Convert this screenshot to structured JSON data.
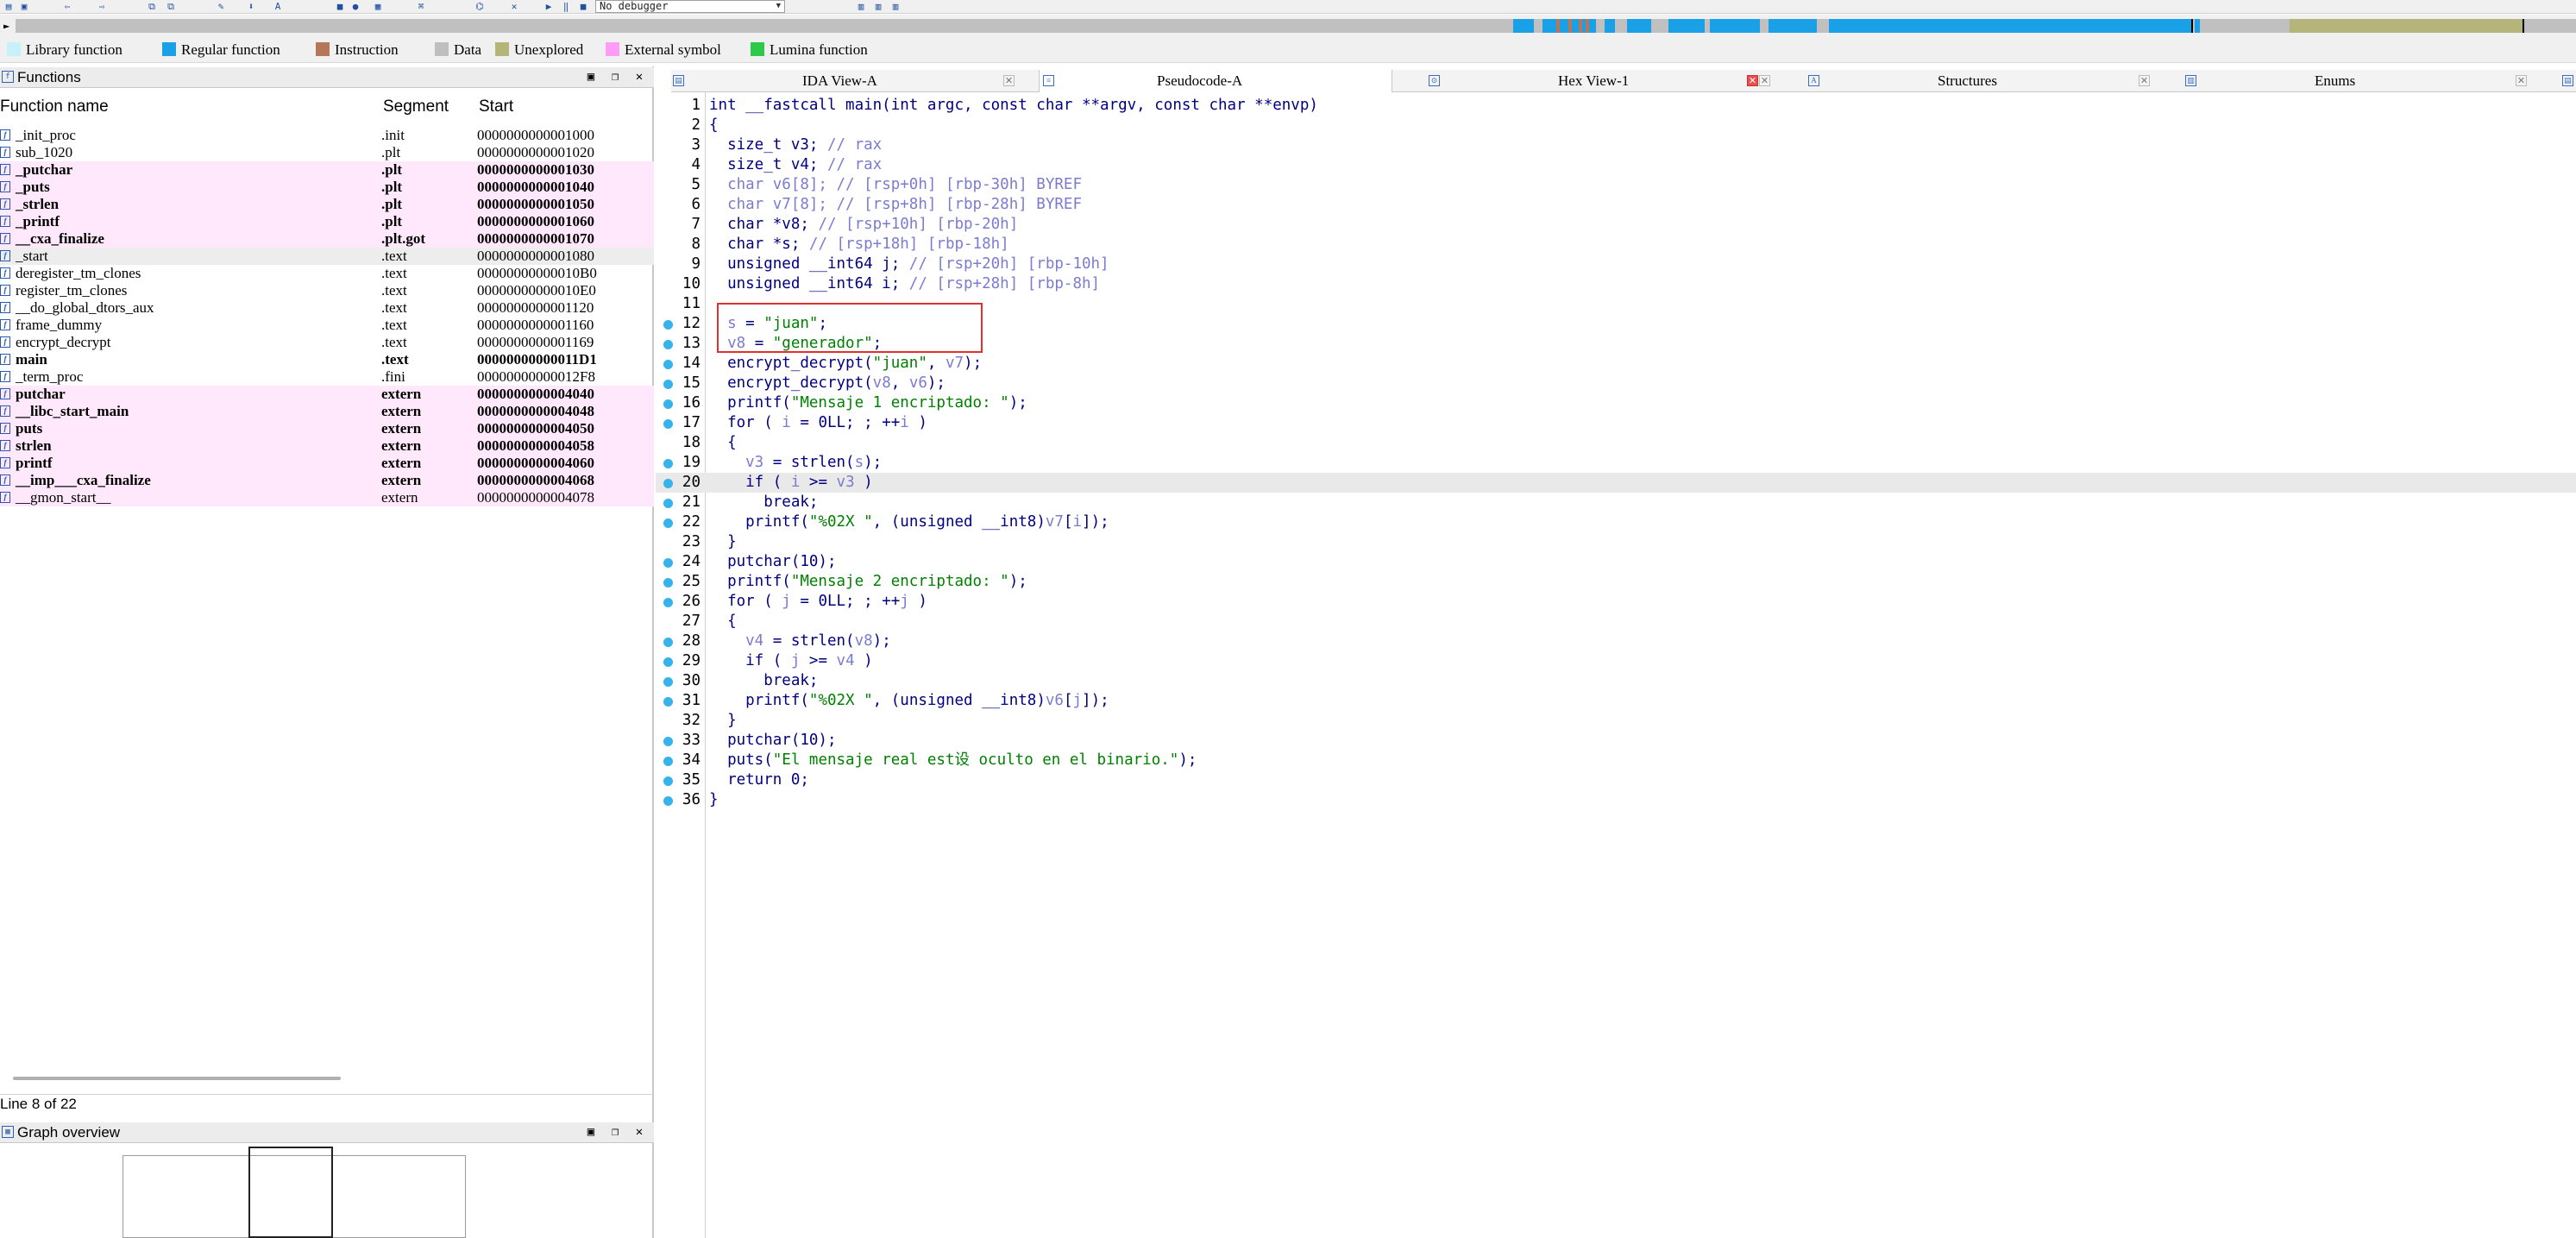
{
  "toolbar": {
    "debugger_select": "No debugger"
  },
  "legend": [
    {
      "label": "Library function",
      "color": "#c8f0f8"
    },
    {
      "label": "Regular function",
      "color": "#1aa0e6"
    },
    {
      "label": "Instruction",
      "color": "#b5765a"
    },
    {
      "label": "Data",
      "color": "#bfbfbf"
    },
    {
      "label": "Unexplored",
      "color": "#b5b47a"
    },
    {
      "label": "External symbol",
      "color": "#ff9cf5"
    },
    {
      "label": "Lumina function",
      "color": "#2ec84a"
    }
  ],
  "functions_panel": {
    "title": "Functions",
    "columns": [
      "Function name",
      "Segment",
      "Start"
    ],
    "rows": [
      {
        "name": "_init_proc",
        "segment": ".init",
        "start": "0000000000001000",
        "style": "normal"
      },
      {
        "name": "sub_1020",
        "segment": ".plt",
        "start": "0000000000001020",
        "style": "normal"
      },
      {
        "name": "_putchar",
        "segment": ".plt",
        "start": "0000000000001030",
        "style": "pink-bold"
      },
      {
        "name": "_puts",
        "segment": ".plt",
        "start": "0000000000001040",
        "style": "pink-bold"
      },
      {
        "name": "_strlen",
        "segment": ".plt",
        "start": "0000000000001050",
        "style": "pink-bold"
      },
      {
        "name": "_printf",
        "segment": ".plt",
        "start": "0000000000001060",
        "style": "pink-bold"
      },
      {
        "name": "__cxa_finalize",
        "segment": ".plt.got",
        "start": "0000000000001070",
        "style": "pink-bold"
      },
      {
        "name": "_start",
        "segment": ".text",
        "start": "0000000000001080",
        "style": "selected"
      },
      {
        "name": "deregister_tm_clones",
        "segment": ".text",
        "start": "00000000000010B0",
        "style": "normal"
      },
      {
        "name": "register_tm_clones",
        "segment": ".text",
        "start": "00000000000010E0",
        "style": "normal"
      },
      {
        "name": "__do_global_dtors_aux",
        "segment": ".text",
        "start": "0000000000001120",
        "style": "normal"
      },
      {
        "name": "frame_dummy",
        "segment": ".text",
        "start": "0000000000001160",
        "style": "normal"
      },
      {
        "name": "encrypt_decrypt",
        "segment": ".text",
        "start": "0000000000001169",
        "style": "normal"
      },
      {
        "name": "main",
        "segment": ".text",
        "start": "00000000000011D1",
        "style": "bold"
      },
      {
        "name": "_term_proc",
        "segment": ".fini",
        "start": "00000000000012F8",
        "style": "normal"
      },
      {
        "name": "putchar",
        "segment": "extern",
        "start": "0000000000004040",
        "style": "pink-bold"
      },
      {
        "name": "__libc_start_main",
        "segment": "extern",
        "start": "0000000000004048",
        "style": "pink-bold"
      },
      {
        "name": "puts",
        "segment": "extern",
        "start": "0000000000004050",
        "style": "pink-bold"
      },
      {
        "name": "strlen",
        "segment": "extern",
        "start": "0000000000004058",
        "style": "pink-bold"
      },
      {
        "name": "printf",
        "segment": "extern",
        "start": "0000000000004060",
        "style": "pink-bold"
      },
      {
        "name": "__imp___cxa_finalize",
        "segment": "extern",
        "start": "0000000000004068",
        "style": "pink-bold"
      },
      {
        "name": "__gmon_start__",
        "segment": "extern",
        "start": "0000000000004078",
        "style": "pink"
      }
    ],
    "status": "Line 8 of 22"
  },
  "graph_overview": {
    "title": "Graph overview"
  },
  "tabs": [
    {
      "label": "IDA View-A",
      "icon": "ida-view-icon",
      "active": false
    },
    {
      "label": "Pseudocode-A",
      "icon": "pseudocode-icon",
      "active": true
    },
    {
      "label": "Hex View-1",
      "icon": "hex-view-icon",
      "active": false
    },
    {
      "label": "Structures",
      "icon": "structures-icon",
      "active": false
    },
    {
      "label": "Enums",
      "icon": "enums-icon",
      "active": false
    }
  ],
  "pseudocode": {
    "highlighted_line": 20,
    "lines": [
      {
        "n": "1",
        "bp": false,
        "parts": [
          [
            "int __fastcall main(int argc, const char **argv, const char **envp)",
            "kw"
          ]
        ]
      },
      {
        "n": "2",
        "bp": false,
        "parts": [
          [
            "{",
            "kw"
          ]
        ]
      },
      {
        "n": "3",
        "bp": false,
        "parts": [
          [
            "  size_t v3; ",
            "kw"
          ],
          [
            "// rax",
            "com"
          ]
        ]
      },
      {
        "n": "4",
        "bp": false,
        "parts": [
          [
            "  size_t v4; ",
            "kw"
          ],
          [
            "// rax",
            "com"
          ]
        ]
      },
      {
        "n": "5",
        "bp": false,
        "parts": [
          [
            "  char v6[8]; ",
            "com"
          ],
          [
            "// [rsp+0h] [rbp-30h] BYREF",
            "com"
          ]
        ]
      },
      {
        "n": "6",
        "bp": false,
        "parts": [
          [
            "  char v7[8]; ",
            "com"
          ],
          [
            "// [rsp+8h] [rbp-28h] BYREF",
            "com"
          ]
        ]
      },
      {
        "n": "7",
        "bp": false,
        "parts": [
          [
            "  char *v8; ",
            "kw"
          ],
          [
            "// [rsp+10h] [rbp-20h]",
            "com"
          ]
        ]
      },
      {
        "n": "8",
        "bp": false,
        "parts": [
          [
            "  char *s; ",
            "kw"
          ],
          [
            "// [rsp+18h] [rbp-18h]",
            "com"
          ]
        ]
      },
      {
        "n": "9",
        "bp": false,
        "parts": [
          [
            "  unsigned __int64 j; ",
            "kw"
          ],
          [
            "// [rsp+20h] [rbp-10h]",
            "com"
          ]
        ]
      },
      {
        "n": "10",
        "bp": false,
        "parts": [
          [
            "  unsigned __int64 i; ",
            "kw"
          ],
          [
            "// [rsp+28h] [rbp-8h]",
            "com"
          ]
        ]
      },
      {
        "n": "11",
        "bp": false,
        "parts": [
          [
            "",
            "kw"
          ]
        ]
      },
      {
        "n": "12",
        "bp": true,
        "parts": [
          [
            "  s",
            "var"
          ],
          [
            " = ",
            "kw"
          ],
          [
            "\"juan\"",
            "str"
          ],
          [
            ";",
            "kw"
          ]
        ]
      },
      {
        "n": "13",
        "bp": true,
        "parts": [
          [
            "  v8",
            "var"
          ],
          [
            " = ",
            "kw"
          ],
          [
            "\"generador\"",
            "str"
          ],
          [
            ";",
            "kw"
          ]
        ]
      },
      {
        "n": "14",
        "bp": true,
        "parts": [
          [
            "  encrypt_decrypt(",
            "kw"
          ],
          [
            "\"juan\"",
            "str"
          ],
          [
            ", ",
            "kw"
          ],
          [
            "v7",
            "var"
          ],
          [
            ");",
            "kw"
          ]
        ]
      },
      {
        "n": "15",
        "bp": true,
        "parts": [
          [
            "  encrypt_decrypt(",
            "kw"
          ],
          [
            "v8",
            "var"
          ],
          [
            ", ",
            "kw"
          ],
          [
            "v6",
            "var"
          ],
          [
            ");",
            "kw"
          ]
        ]
      },
      {
        "n": "16",
        "bp": true,
        "parts": [
          [
            "  printf(",
            "kw"
          ],
          [
            "\"Mensaje 1 encriptado: \"",
            "str"
          ],
          [
            ");",
            "kw"
          ]
        ]
      },
      {
        "n": "17",
        "bp": true,
        "parts": [
          [
            "  for ( ",
            "kw"
          ],
          [
            "i",
            "var"
          ],
          [
            " = 0LL; ; ++",
            "kw"
          ],
          [
            "i",
            "var"
          ],
          [
            " )",
            "kw"
          ]
        ]
      },
      {
        "n": "18",
        "bp": false,
        "parts": [
          [
            "  {",
            "kw"
          ]
        ]
      },
      {
        "n": "19",
        "bp": true,
        "parts": [
          [
            "    v3",
            "var"
          ],
          [
            " = strlen(",
            "kw"
          ],
          [
            "s",
            "var"
          ],
          [
            ");",
            "kw"
          ]
        ]
      },
      {
        "n": "20",
        "bp": true,
        "parts": [
          [
            "    if ( ",
            "kw"
          ],
          [
            "i",
            "var"
          ],
          [
            " >= ",
            "kw"
          ],
          [
            "v3",
            "var"
          ],
          [
            " )",
            "kw"
          ]
        ]
      },
      {
        "n": "21",
        "bp": true,
        "parts": [
          [
            "      break;",
            "kw"
          ]
        ]
      },
      {
        "n": "22",
        "bp": true,
        "parts": [
          [
            "    printf(",
            "kw"
          ],
          [
            "\"%02X \"",
            "str"
          ],
          [
            ", (unsigned __int8)",
            "kw"
          ],
          [
            "v7",
            "var"
          ],
          [
            "[",
            "kw"
          ],
          [
            "i",
            "var"
          ],
          [
            "]);",
            "kw"
          ]
        ]
      },
      {
        "n": "23",
        "bp": false,
        "parts": [
          [
            "  }",
            "kw"
          ]
        ]
      },
      {
        "n": "24",
        "bp": true,
        "parts": [
          [
            "  putchar(10);",
            "kw"
          ]
        ]
      },
      {
        "n": "25",
        "bp": true,
        "parts": [
          [
            "  printf(",
            "kw"
          ],
          [
            "\"Mensaje 2 encriptado: \"",
            "str"
          ],
          [
            ");",
            "kw"
          ]
        ]
      },
      {
        "n": "26",
        "bp": true,
        "parts": [
          [
            "  for ( ",
            "kw"
          ],
          [
            "j",
            "var"
          ],
          [
            " = 0LL; ; ++",
            "kw"
          ],
          [
            "j",
            "var"
          ],
          [
            " )",
            "kw"
          ]
        ]
      },
      {
        "n": "27",
        "bp": false,
        "parts": [
          [
            "  {",
            "kw"
          ]
        ]
      },
      {
        "n": "28",
        "bp": true,
        "parts": [
          [
            "    v4",
            "var"
          ],
          [
            " = strlen(",
            "kw"
          ],
          [
            "v8",
            "var"
          ],
          [
            ");",
            "kw"
          ]
        ]
      },
      {
        "n": "29",
        "bp": true,
        "parts": [
          [
            "    if ( ",
            "kw"
          ],
          [
            "j",
            "var"
          ],
          [
            " >= ",
            "kw"
          ],
          [
            "v4",
            "var"
          ],
          [
            " )",
            "kw"
          ]
        ]
      },
      {
        "n": "30",
        "bp": true,
        "parts": [
          [
            "      break;",
            "kw"
          ]
        ]
      },
      {
        "n": "31",
        "bp": true,
        "parts": [
          [
            "    printf(",
            "kw"
          ],
          [
            "\"%02X \"",
            "str"
          ],
          [
            ", (unsigned __int8)",
            "kw"
          ],
          [
            "v6",
            "var"
          ],
          [
            "[",
            "kw"
          ],
          [
            "j",
            "var"
          ],
          [
            "]);",
            "kw"
          ]
        ]
      },
      {
        "n": "32",
        "bp": false,
        "parts": [
          [
            "  }",
            "kw"
          ]
        ]
      },
      {
        "n": "33",
        "bp": true,
        "parts": [
          [
            "  putchar(10);",
            "kw"
          ]
        ]
      },
      {
        "n": "34",
        "bp": true,
        "parts": [
          [
            "  puts(",
            "kw"
          ],
          [
            "\"El mensaje real est设 oculto en el binario.\"",
            "str"
          ],
          [
            ");",
            "kw"
          ]
        ]
      },
      {
        "n": "35",
        "bp": true,
        "parts": [
          [
            "  return 0;",
            "kw"
          ]
        ]
      },
      {
        "n": "36",
        "bp": true,
        "parts": [
          [
            "}",
            "kw"
          ]
        ]
      }
    ]
  }
}
